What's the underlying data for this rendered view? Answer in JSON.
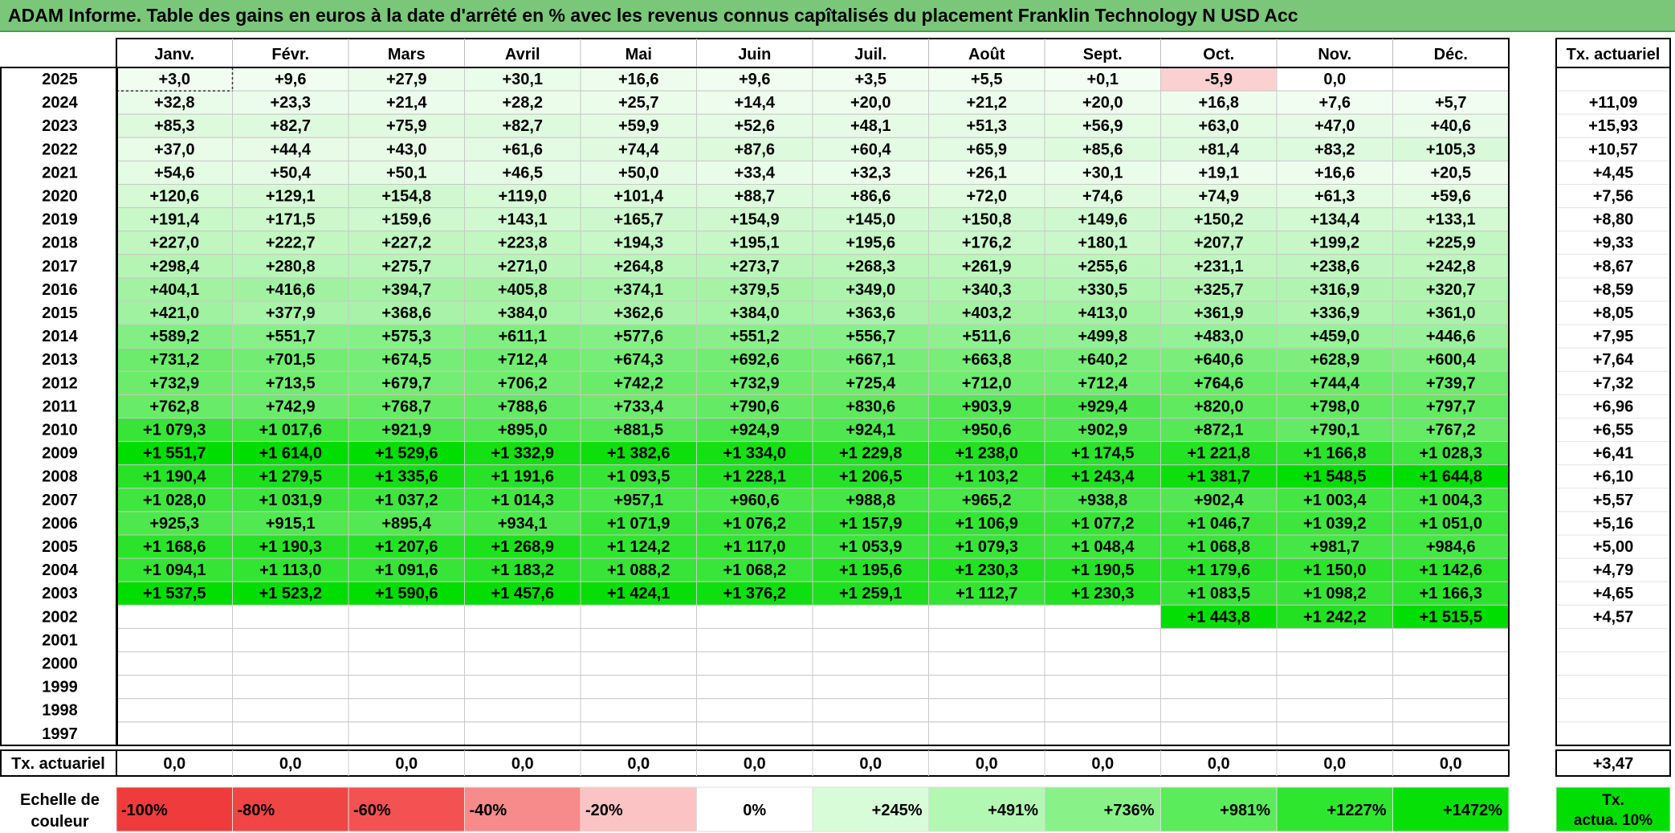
{
  "title": "ADAM Informe. Table des gains en euros à la date d'arrêté en % avec les revenus connus capîtalisés du placement Franklin Technology N USD Acc",
  "chart_data": {
    "type": "heatmap",
    "months": [
      "Janv.",
      "Févr.",
      "Mars",
      "Avril",
      "Mai",
      "Juin",
      "Juil.",
      "Août",
      "Sept.",
      "Oct.",
      "Nov.",
      "Déc."
    ],
    "rate_header": "Tx. actuariel",
    "rows": [
      {
        "year": "2025",
        "values": [
          "+3,0",
          "+9,6",
          "+27,9",
          "+30,1",
          "+16,6",
          "+9,6",
          "+3,5",
          "+5,5",
          "+0,1",
          "-5,9",
          "0,0",
          ""
        ],
        "rate": ""
      },
      {
        "year": "2024",
        "values": [
          "+32,8",
          "+23,3",
          "+21,4",
          "+28,2",
          "+25,7",
          "+14,4",
          "+20,0",
          "+21,2",
          "+20,0",
          "+16,8",
          "+7,6",
          "+5,7"
        ],
        "rate": "+11,09"
      },
      {
        "year": "2023",
        "values": [
          "+85,3",
          "+82,7",
          "+75,9",
          "+82,7",
          "+59,9",
          "+52,6",
          "+48,1",
          "+51,3",
          "+56,9",
          "+63,0",
          "+47,0",
          "+40,6"
        ],
        "rate": "+15,93"
      },
      {
        "year": "2022",
        "values": [
          "+37,0",
          "+44,4",
          "+43,0",
          "+61,6",
          "+74,4",
          "+87,6",
          "+60,4",
          "+65,9",
          "+85,6",
          "+81,4",
          "+83,2",
          "+105,3"
        ],
        "rate": "+10,57"
      },
      {
        "year": "2021",
        "values": [
          "+54,6",
          "+50,4",
          "+50,1",
          "+46,5",
          "+50,0",
          "+33,4",
          "+32,3",
          "+26,1",
          "+30,1",
          "+19,1",
          "+16,6",
          "+20,5"
        ],
        "rate": "+4,45"
      },
      {
        "year": "2020",
        "values": [
          "+120,6",
          "+129,1",
          "+154,8",
          "+119,0",
          "+101,4",
          "+88,7",
          "+86,6",
          "+72,0",
          "+74,6",
          "+74,9",
          "+61,3",
          "+59,6"
        ],
        "rate": "+7,56"
      },
      {
        "year": "2019",
        "values": [
          "+191,4",
          "+171,5",
          "+159,6",
          "+143,1",
          "+165,7",
          "+154,9",
          "+145,0",
          "+150,8",
          "+149,6",
          "+150,2",
          "+134,4",
          "+133,1"
        ],
        "rate": "+8,80"
      },
      {
        "year": "2018",
        "values": [
          "+227,0",
          "+222,7",
          "+227,2",
          "+223,8",
          "+194,3",
          "+195,1",
          "+195,6",
          "+176,2",
          "+180,1",
          "+207,7",
          "+199,2",
          "+225,9"
        ],
        "rate": "+9,33"
      },
      {
        "year": "2017",
        "values": [
          "+298,4",
          "+280,8",
          "+275,7",
          "+271,0",
          "+264,8",
          "+273,7",
          "+268,3",
          "+261,9",
          "+255,6",
          "+231,1",
          "+238,6",
          "+242,8"
        ],
        "rate": "+8,67"
      },
      {
        "year": "2016",
        "values": [
          "+404,1",
          "+416,6",
          "+394,7",
          "+405,8",
          "+374,1",
          "+379,5",
          "+349,0",
          "+340,3",
          "+330,5",
          "+325,7",
          "+316,9",
          "+320,7"
        ],
        "rate": "+8,59"
      },
      {
        "year": "2015",
        "values": [
          "+421,0",
          "+377,9",
          "+368,6",
          "+384,0",
          "+362,6",
          "+384,0",
          "+363,6",
          "+403,2",
          "+413,0",
          "+361,9",
          "+336,9",
          "+361,0"
        ],
        "rate": "+8,05"
      },
      {
        "year": "2014",
        "values": [
          "+589,2",
          "+551,7",
          "+575,3",
          "+611,1",
          "+577,6",
          "+551,2",
          "+556,7",
          "+511,6",
          "+499,8",
          "+483,0",
          "+459,0",
          "+446,6"
        ],
        "rate": "+7,95"
      },
      {
        "year": "2013",
        "values": [
          "+731,2",
          "+701,5",
          "+674,5",
          "+712,4",
          "+674,3",
          "+692,6",
          "+667,1",
          "+663,8",
          "+640,2",
          "+640,6",
          "+628,9",
          "+600,4"
        ],
        "rate": "+7,64"
      },
      {
        "year": "2012",
        "values": [
          "+732,9",
          "+713,5",
          "+679,7",
          "+706,2",
          "+742,2",
          "+732,9",
          "+725,4",
          "+712,0",
          "+712,4",
          "+764,6",
          "+744,4",
          "+739,7"
        ],
        "rate": "+7,32"
      },
      {
        "year": "2011",
        "values": [
          "+762,8",
          "+742,9",
          "+768,7",
          "+788,6",
          "+733,4",
          "+790,6",
          "+830,6",
          "+903,9",
          "+929,4",
          "+820,0",
          "+798,0",
          "+797,7"
        ],
        "rate": "+6,96"
      },
      {
        "year": "2010",
        "values": [
          "+1 079,3",
          "+1 017,6",
          "+921,9",
          "+895,0",
          "+881,5",
          "+924,9",
          "+924,1",
          "+950,6",
          "+902,9",
          "+872,1",
          "+790,1",
          "+767,2"
        ],
        "rate": "+6,55"
      },
      {
        "year": "2009",
        "values": [
          "+1 551,7",
          "+1 614,0",
          "+1 529,6",
          "+1 332,9",
          "+1 382,6",
          "+1 334,0",
          "+1 229,8",
          "+1 238,0",
          "+1 174,5",
          "+1 221,8",
          "+1 166,8",
          "+1 028,3"
        ],
        "rate": "+6,41"
      },
      {
        "year": "2008",
        "values": [
          "+1 190,4",
          "+1 279,5",
          "+1 335,6",
          "+1 191,6",
          "+1 093,5",
          "+1 228,1",
          "+1 206,5",
          "+1 103,2",
          "+1 243,4",
          "+1 381,7",
          "+1 548,5",
          "+1 644,8"
        ],
        "rate": "+6,10"
      },
      {
        "year": "2007",
        "values": [
          "+1 028,0",
          "+1 031,9",
          "+1 037,2",
          "+1 014,3",
          "+957,1",
          "+960,6",
          "+988,8",
          "+965,2",
          "+938,8",
          "+902,4",
          "+1 003,4",
          "+1 004,3"
        ],
        "rate": "+5,57"
      },
      {
        "year": "2006",
        "values": [
          "+925,3",
          "+915,1",
          "+895,4",
          "+934,1",
          "+1 071,9",
          "+1 076,2",
          "+1 157,9",
          "+1 106,9",
          "+1 077,2",
          "+1 046,7",
          "+1 039,2",
          "+1 051,0"
        ],
        "rate": "+5,16"
      },
      {
        "year": "2005",
        "values": [
          "+1 168,6",
          "+1 190,3",
          "+1 207,6",
          "+1 268,9",
          "+1 124,2",
          "+1 117,0",
          "+1 053,9",
          "+1 079,3",
          "+1 048,4",
          "+1 068,8",
          "+981,7",
          "+984,6"
        ],
        "rate": "+5,00"
      },
      {
        "year": "2004",
        "values": [
          "+1 094,1",
          "+1 113,0",
          "+1 091,6",
          "+1 183,2",
          "+1 088,2",
          "+1 068,2",
          "+1 195,6",
          "+1 230,3",
          "+1 190,5",
          "+1 179,6",
          "+1 150,0",
          "+1 142,6"
        ],
        "rate": "+4,79"
      },
      {
        "year": "2003",
        "values": [
          "+1 537,5",
          "+1 523,2",
          "+1 590,6",
          "+1 457,6",
          "+1 424,1",
          "+1 376,2",
          "+1 259,1",
          "+1 112,7",
          "+1 230,3",
          "+1 083,5",
          "+1 098,2",
          "+1 166,3"
        ],
        "rate": "+4,65"
      },
      {
        "year": "2002",
        "values": [
          "",
          "",
          "",
          "",
          "",
          "",
          "",
          "",
          "",
          "+1 443,8",
          "+1 242,2",
          "+1 515,5"
        ],
        "rate": "+4,57"
      },
      {
        "year": "2001",
        "values": [
          "",
          "",
          "",
          "",
          "",
          "",
          "",
          "",
          "",
          "",
          "",
          ""
        ],
        "rate": ""
      },
      {
        "year": "2000",
        "values": [
          "",
          "",
          "",
          "",
          "",
          "",
          "",
          "",
          "",
          "",
          "",
          ""
        ],
        "rate": ""
      },
      {
        "year": "1999",
        "values": [
          "",
          "",
          "",
          "",
          "",
          "",
          "",
          "",
          "",
          "",
          "",
          ""
        ],
        "rate": ""
      },
      {
        "year": "1998",
        "values": [
          "",
          "",
          "",
          "",
          "",
          "",
          "",
          "",
          "",
          "",
          "",
          ""
        ],
        "rate": ""
      },
      {
        "year": "1997",
        "values": [
          "",
          "",
          "",
          "",
          "",
          "",
          "",
          "",
          "",
          "",
          "",
          ""
        ],
        "rate": ""
      }
    ],
    "footer": {
      "label": "Tx. actuariel",
      "values": [
        "0,0",
        "0,0",
        "0,0",
        "0,0",
        "0,0",
        "0,0",
        "0,0",
        "0,0",
        "0,0",
        "0,0",
        "0,0",
        "0,0"
      ],
      "rate": "+3,47"
    },
    "legend": {
      "label_line1": "Echelle de",
      "label_line2": "couleur",
      "items": [
        {
          "text": "-100%",
          "color": "#ef3b3b"
        },
        {
          "text": "-80%",
          "color": "#f04545"
        },
        {
          "text": "-60%",
          "color": "#f45252"
        },
        {
          "text": "-40%",
          "color": "#f78a8a"
        },
        {
          "text": "-20%",
          "color": "#fbc3c3"
        },
        {
          "text": "0%",
          "color": "#ffffff"
        },
        {
          "text": "+245%",
          "color": "#d8fcd8"
        },
        {
          "text": "+491%",
          "color": "#b2f7b2"
        },
        {
          "text": "+736%",
          "color": "#88f288"
        },
        {
          "text": "+981%",
          "color": "#5bec5b"
        },
        {
          "text": "+1227%",
          "color": "#2fe62f"
        },
        {
          "text": "+1472%",
          "color": "#07e007"
        }
      ],
      "rate_line1": "Tx.",
      "rate_line2": "actua. 10%",
      "rate_color": "#00dd00"
    },
    "scale": {
      "neg_color": "#fbd0d0",
      "pos_min": "#f3fdf3",
      "pos_max": "#00dd00",
      "pos_max_value": 1472
    }
  }
}
